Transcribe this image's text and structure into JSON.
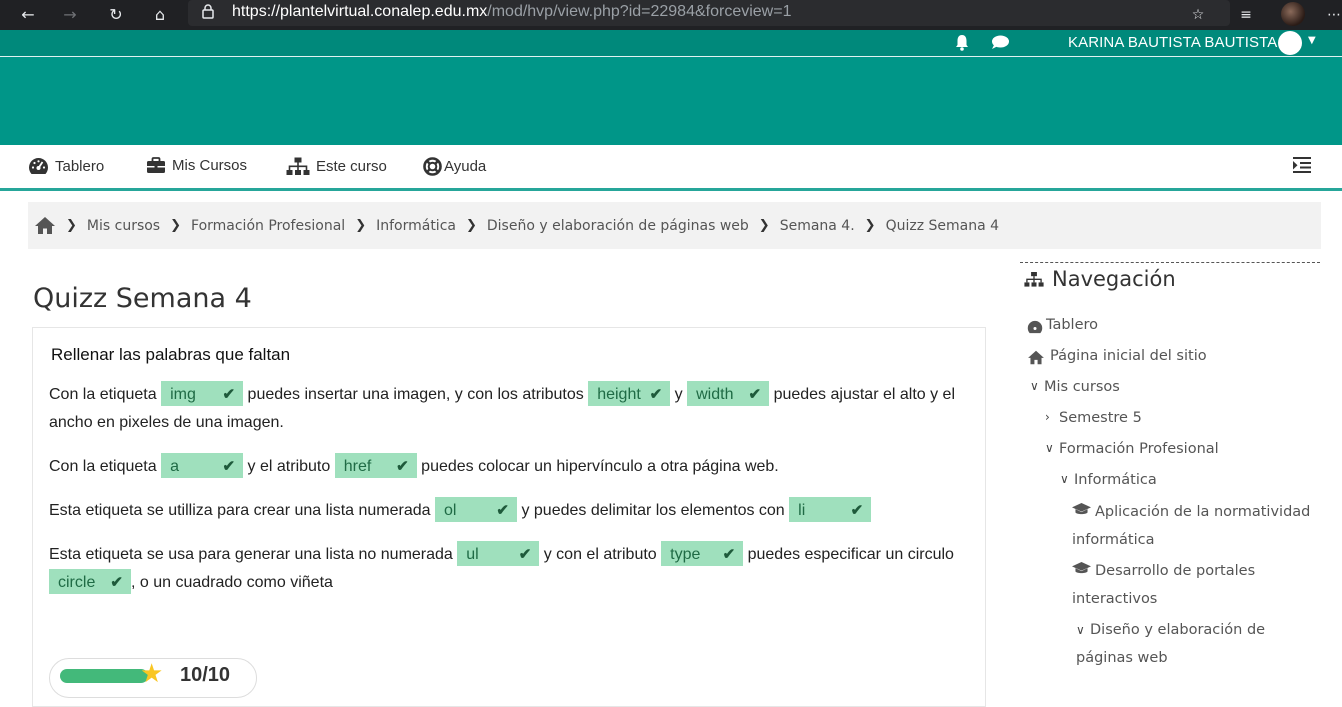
{
  "browser": {
    "url_prefix": "https://",
    "url_host": "plantelvirtual.conalep.edu.mx",
    "url_path": "/mod/hvp/view.php?id=22984&forceview=1"
  },
  "header": {
    "user_name": "KARINA BAUTISTA BAUTISTA"
  },
  "course_nav": {
    "items": [
      {
        "label": "Tablero"
      },
      {
        "label": "Mis Cursos"
      },
      {
        "label": "Este curso"
      },
      {
        "label": "Ayuda"
      }
    ]
  },
  "breadcrumb": {
    "items": [
      "Mis cursos",
      "Formación Profesional",
      "Informática",
      "Diseño y elaboración de páginas web",
      "Semana 4.",
      "Quizz Semana 4"
    ]
  },
  "main": {
    "title": "Quizz Semana 4",
    "quiz": {
      "heading": "Rellenar las palabras que faltan",
      "p1_a": "Con la etiqueta",
      "p1_ans1": "img",
      "p1_b": "puedes insertar una imagen, y con los atributos",
      "p1_ans2": "height",
      "p1_c": "y",
      "p1_ans3": "width",
      "p1_d": "puedes ajustar el alto y el ancho en pixeles de una imagen.",
      "p2_a": "Con la etiqueta",
      "p2_ans1": "a",
      "p2_b": "y el atributo",
      "p2_ans2": "href",
      "p2_c": "puedes colocar un hipervínculo a otra página web.",
      "p3_a": "Esta etiqueta se utilliza para crear una lista numerada",
      "p3_ans1": "ol",
      "p3_b": "y puedes delimitar los elementos con",
      "p3_ans2": "li",
      "p4_a": "Esta etiqueta se usa para generar una lista no numerada",
      "p4_ans1": "ul",
      "p4_b": "y con el atributo",
      "p4_ans2": "type",
      "p4_c": "puedes especificar un circulo",
      "p4_ans3": "circle",
      "p4_d": ", o un cuadrado como viñeta",
      "score": "10/10",
      "score_fraction": 1.0
    }
  },
  "side_nav": {
    "title": "Navegación",
    "entries": {
      "tablero": "Tablero",
      "pagina_inicial": "Página inicial del sitio",
      "mis_cursos": "Mis cursos",
      "semestre5": "Semestre 5",
      "formacion": "Formación Profesional",
      "informatica": "Informática",
      "aplicacion": "Aplicación de la normatividad informática",
      "desarrollo": "Desarrollo de portales interactivos",
      "diseno": "Diseño y elaboración de páginas web"
    }
  },
  "colors": {
    "header": "#009688",
    "nav_border": "#26a69a",
    "answer_bg": "#9fe0bd",
    "score_bar": "#43b97a"
  }
}
